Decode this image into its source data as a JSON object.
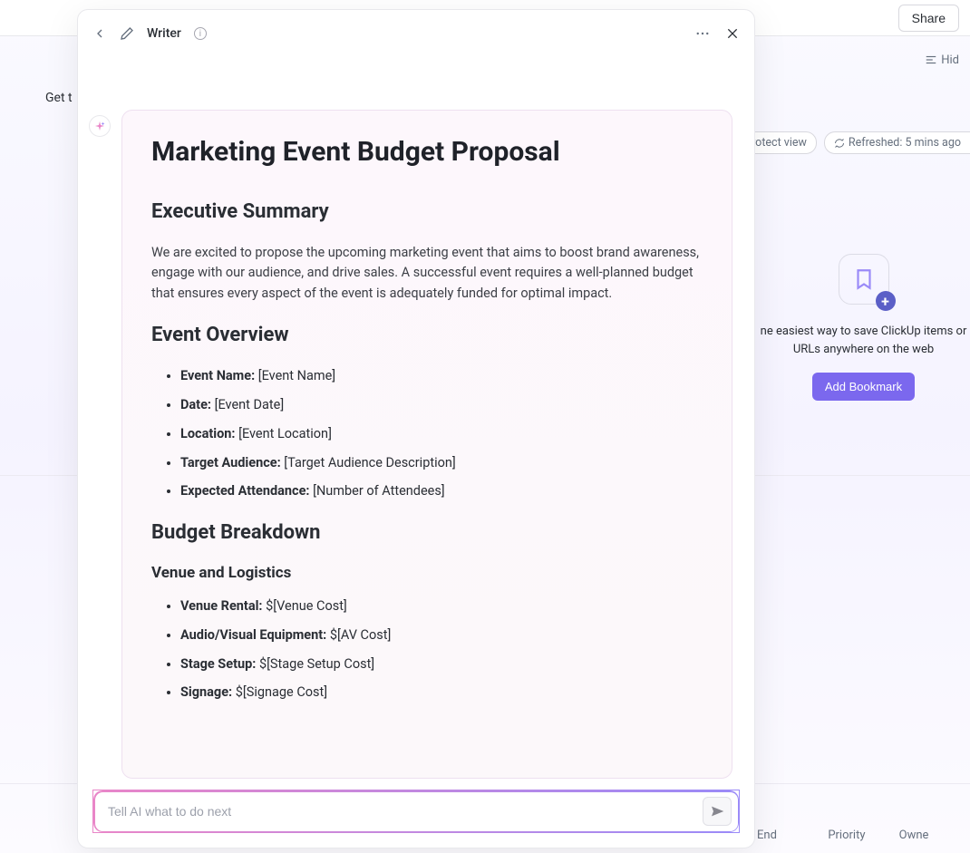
{
  "topbar": {
    "share": "Share"
  },
  "toolbar2": {
    "hide": "Hid"
  },
  "hint": "Get t",
  "toolbar3": {
    "protect": "Protect view",
    "refreshed": "Refreshed: 5 mins ago"
  },
  "bookmark": {
    "text": "ne easiest way to save ClickUp items or URLs anywhere on the web",
    "button": "Add Bookmark"
  },
  "columns": {
    "end": "End",
    "priority": "Priority",
    "owner": "Owne"
  },
  "modal": {
    "title": "Writer",
    "prompt_placeholder": "Tell AI what to do next"
  },
  "doc": {
    "title": "Marketing Event Budget Proposal",
    "exec_heading": "Executive Summary",
    "exec_body": "We are excited to propose the upcoming marketing event that aims to boost brand awareness, engage with our audience, and drive sales. A successful event requires a well-planned budget that ensures every aspect of the event is adequately funded for optimal impact.",
    "overview_heading": "Event Overview",
    "overview_items": {
      "event_name_label": "Event Name:",
      "event_name_value": " [Event Name]",
      "date_label": "Date:",
      "date_value": " [Event Date]",
      "location_label": "Location:",
      "location_value": " [Event Location]",
      "audience_label": "Target Audience:",
      "audience_value": " [Target Audience Description]",
      "attendance_label": "Expected Attendance:",
      "attendance_value": " [Number of Attendees]"
    },
    "budget_heading": "Budget Breakdown",
    "venue_heading": "Venue and Logistics",
    "venue_items": {
      "venue_rental_label": "Venue Rental:",
      "venue_rental_value": " $[Venue Cost]",
      "av_label": "Audio/Visual Equipment:",
      "av_value": " $[AV Cost]",
      "stage_label": "Stage Setup:",
      "stage_value": " $[Stage Setup Cost]",
      "signage_label": "Signage:",
      "signage_value": " $[Signage Cost]"
    }
  }
}
